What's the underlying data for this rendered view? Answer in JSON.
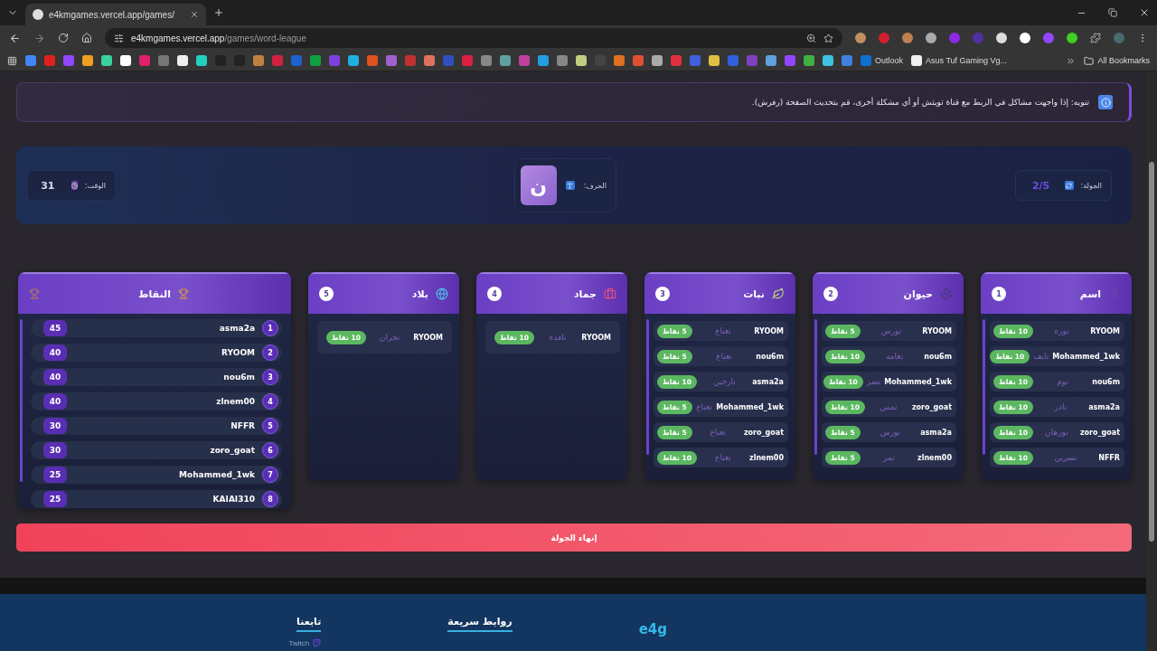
{
  "browser": {
    "tab_title": "e4kmgames.vercel.app/games/",
    "url_host": "e4kmgames.vercel.app",
    "url_path": "/games/word-league",
    "outlook_bookmark": "Outlook",
    "monitor_bookmark": "Asus Tuf Gaming Vg...",
    "all_bookmarks": "All Bookmarks"
  },
  "notice": "تنويه: إذا واجهت مشاكل في الربط مع قناة تويتش أو أي مشكلة أخرى، قم بتحديث الصفحة (رفرش).",
  "round_bar": {
    "round_label": "الجولة:",
    "round_value": "2/5",
    "letter_label": "الحرف:",
    "letter": "ن",
    "time_label": "الوقت:",
    "time_value": "31"
  },
  "categories": [
    {
      "number": "1",
      "title": "اسم",
      "kind": "person",
      "entries": [
        {
          "player": "RYOOM",
          "answer": "نوره",
          "points": "10 نقاط"
        },
        {
          "player": "Mohammed_1wk",
          "answer": "نايف",
          "points": "10 نقاط"
        },
        {
          "player": "nou6m",
          "answer": "نوم",
          "points": "10 نقاط"
        },
        {
          "player": "asma2a",
          "answer": "نادر",
          "points": "10 نقاط"
        },
        {
          "player": "zoro_goat",
          "answer": "نورهان",
          "points": "10 نقاط"
        },
        {
          "player": "NFFR",
          "answer": "نسرين",
          "points": "10 نقاط"
        }
      ]
    },
    {
      "number": "2",
      "title": "حيوان",
      "kind": "paw",
      "entries": [
        {
          "player": "RYOOM",
          "answer": "نورس",
          "points": "5 نقاط"
        },
        {
          "player": "nou6m",
          "answer": "نعامه",
          "points": "10 نقاط"
        },
        {
          "player": "Mohammed_1wk",
          "answer": "نسر",
          "points": "10 نقاط"
        },
        {
          "player": "zoro_goat",
          "answer": "نمس",
          "points": "10 نقاط"
        },
        {
          "player": "asma2a",
          "answer": "نورس",
          "points": "5 نقاط"
        },
        {
          "player": "zlnem00",
          "answer": "نمر",
          "points": "5 نقاط"
        }
      ]
    },
    {
      "number": "3",
      "title": "نبات",
      "kind": "leaf",
      "entries": [
        {
          "player": "RYOOM",
          "answer": "نعناع",
          "points": "5 نقاط"
        },
        {
          "player": "nou6m",
          "answer": "نعناع",
          "points": "5 نقاط"
        },
        {
          "player": "asma2a",
          "answer": "نارجين",
          "points": "10 نقاط"
        },
        {
          "player": "Mohammed_1wk",
          "answer": "نعناع",
          "points": "5 نقاط"
        },
        {
          "player": "zoro_goat",
          "answer": "نعناع",
          "points": "5 نقاط"
        },
        {
          "player": "zlnem00",
          "answer": "نعناع",
          "points": "10 نقاط"
        }
      ]
    },
    {
      "number": "4",
      "title": "جماد",
      "kind": "box",
      "entries": [
        {
          "player": "RYOOM",
          "answer": "نافذه",
          "points": "10 نقاط"
        }
      ]
    },
    {
      "number": "5",
      "title": "بلاد",
      "kind": "globe",
      "entries": [
        {
          "player": "RYOOM",
          "answer": "نجران",
          "points": "10 نقاط"
        }
      ]
    }
  ],
  "leaderboard": {
    "title": "النقاط",
    "rows": [
      {
        "rank": "1",
        "name": "asma2a",
        "score": "45"
      },
      {
        "rank": "2",
        "name": "RYOOM",
        "score": "40"
      },
      {
        "rank": "3",
        "name": "nou6m",
        "score": "40"
      },
      {
        "rank": "4",
        "name": "zlnem00",
        "score": "40"
      },
      {
        "rank": "5",
        "name": "NFFR",
        "score": "30"
      },
      {
        "rank": "6",
        "name": "zoro_goat",
        "score": "30"
      },
      {
        "rank": "7",
        "name": "Mohammed_1wk",
        "score": "25"
      },
      {
        "rank": "8",
        "name": "KAIAI310",
        "score": "25"
      }
    ]
  },
  "end_button": "إنهاء الجولة",
  "footer": {
    "logo": "e4g",
    "sections": [
      {
        "heading": "روابط سريعة"
      },
      {
        "heading": "تابعنا",
        "links": [
          "Twitch"
        ]
      }
    ]
  }
}
